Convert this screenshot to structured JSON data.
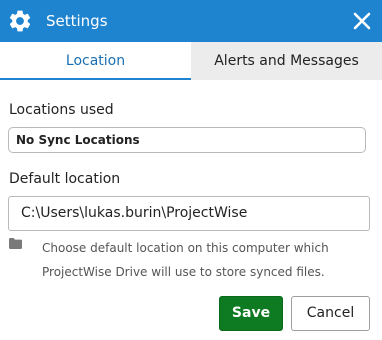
{
  "window": {
    "title": "Settings",
    "icon": "gear-icon",
    "close_icon": "close-icon"
  },
  "tabs": [
    {
      "label": "Location",
      "active": true
    },
    {
      "label": "Alerts and Messages",
      "active": false
    }
  ],
  "locations_used": {
    "label": "Locations used",
    "value": "No Sync Locations"
  },
  "default_location": {
    "label": "Default location",
    "value": "C:\\Users\\lukas.burin\\ProjectWise",
    "help_line1": "Choose default location on this computer which",
    "help_line2": "ProjectWise Drive will use to store synced files."
  },
  "buttons": {
    "save": "Save",
    "cancel": "Cancel"
  },
  "colors": {
    "title_bar": "#1f84cf",
    "active_tab_text": "#1a6fb3",
    "save_button": "#0e7a22"
  }
}
